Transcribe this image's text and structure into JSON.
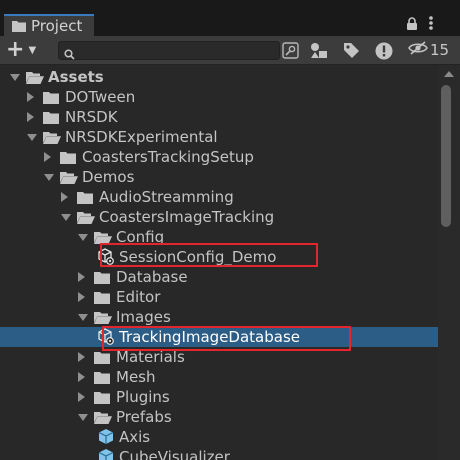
{
  "window": {
    "tab_title": "Project"
  },
  "toolbar": {
    "add_label": "+",
    "search_placeholder": "",
    "search_value": "",
    "hidden_count": "15"
  },
  "tree": {
    "rows": [
      {
        "label": "Assets",
        "level": 0,
        "expanded": true,
        "kind": "folder-open",
        "bold": true
      },
      {
        "label": "DOTween",
        "level": 1,
        "expanded": false,
        "kind": "folder"
      },
      {
        "label": "NRSDK",
        "level": 1,
        "expanded": false,
        "kind": "folder"
      },
      {
        "label": "NRSDKExperimental",
        "level": 1,
        "expanded": true,
        "kind": "folder-open"
      },
      {
        "label": "CoastersTrackingSetup",
        "level": 2,
        "expanded": false,
        "kind": "folder"
      },
      {
        "label": "Demos",
        "level": 2,
        "expanded": true,
        "kind": "folder-open"
      },
      {
        "label": "AudioStreamming",
        "level": 3,
        "expanded": false,
        "kind": "folder"
      },
      {
        "label": "CoastersImageTracking",
        "level": 3,
        "expanded": true,
        "kind": "folder-open"
      },
      {
        "label": "Config",
        "level": 4,
        "expanded": true,
        "kind": "folder-open"
      },
      {
        "label": "SessionConfig_Demo",
        "level": 5,
        "kind": "asset",
        "highlighted": true
      },
      {
        "label": "Database",
        "level": 4,
        "expanded": false,
        "kind": "folder"
      },
      {
        "label": "Editor",
        "level": 4,
        "expanded": false,
        "kind": "folder"
      },
      {
        "label": "Images",
        "level": 4,
        "expanded": true,
        "kind": "folder-open"
      },
      {
        "label": "TrackingImageDatabase",
        "level": 5,
        "kind": "asset",
        "selected": true,
        "highlighted": true
      },
      {
        "label": "Materials",
        "level": 4,
        "expanded": false,
        "kind": "folder"
      },
      {
        "label": "Mesh",
        "level": 4,
        "expanded": false,
        "kind": "folder"
      },
      {
        "label": "Plugins",
        "level": 4,
        "expanded": false,
        "kind": "folder"
      },
      {
        "label": "Prefabs",
        "level": 4,
        "expanded": true,
        "kind": "folder-open"
      },
      {
        "label": "Axis",
        "level": 5,
        "kind": "prefab"
      },
      {
        "label": "CubeVisualizer",
        "level": 5,
        "kind": "prefab"
      }
    ]
  },
  "colors": {
    "selection": "#2c5d87",
    "highlight_box": "#e2262e",
    "prefab": "#7fc4ea"
  }
}
